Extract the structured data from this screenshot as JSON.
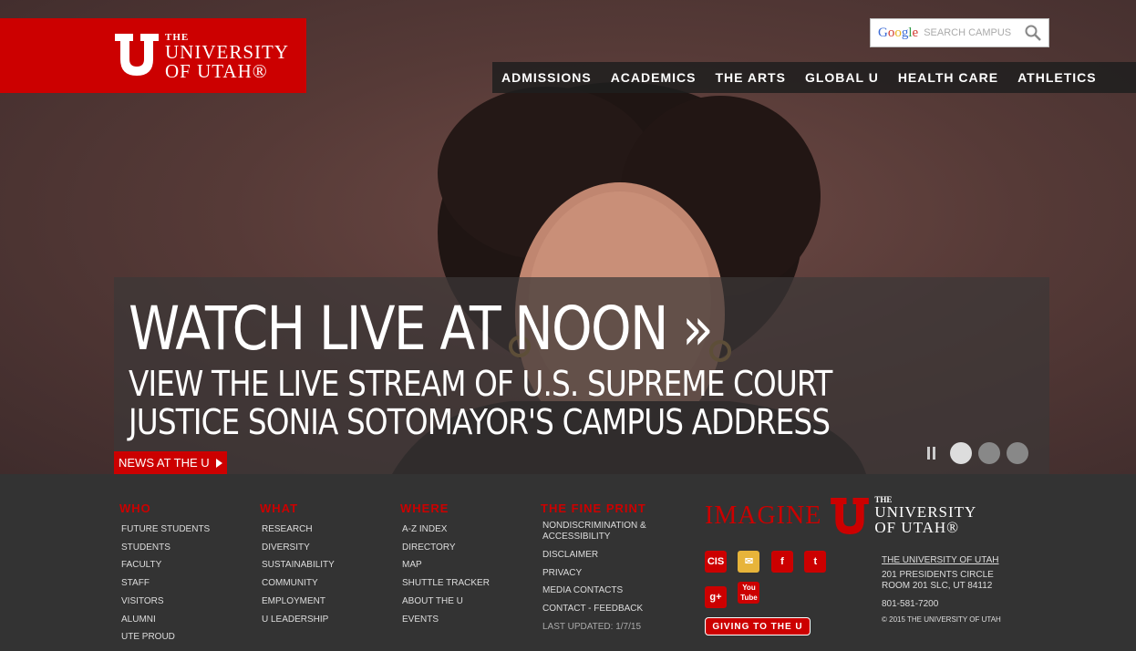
{
  "header": {
    "logo": {
      "the": "THE",
      "line1": "UNIVERSITY",
      "line2": "OF UTAH®"
    },
    "search": {
      "placeholder": "SEARCH CAMPUS",
      "brand": "Google"
    },
    "nav": [
      "ADMISSIONS",
      "ACADEMICS",
      "THE ARTS",
      "GLOBAL U",
      "HEALTH CARE",
      "ATHLETICS"
    ]
  },
  "hero": {
    "title": "WATCH LIVE AT NOON »",
    "subtitle": "VIEW THE LIVE STREAM OF U.S. SUPREME COURT JUSTICE SONIA SOTOMAYOR'S CAMPUS ADDRESS",
    "tag": "NEWS AT THE U",
    "slide_count": 3,
    "active_slide": 1
  },
  "footer": {
    "who": {
      "heading": "WHO",
      "links": [
        "FUTURE STUDENTS",
        "STUDENTS",
        "FACULTY",
        "STAFF",
        "VISITORS",
        "ALUMNI",
        "UTE PROUD"
      ]
    },
    "what": {
      "heading": "WHAT",
      "links": [
        "RESEARCH",
        "DIVERSITY",
        "SUSTAINABILITY",
        "COMMUNITY",
        "EMPLOYMENT",
        "U LEADERSHIP"
      ]
    },
    "where": {
      "heading": "WHERE",
      "links": [
        "A-Z INDEX",
        "DIRECTORY",
        "MAP",
        "SHUTTLE TRACKER",
        "ABOUT THE U",
        "EVENTS"
      ]
    },
    "fineprint": {
      "heading": "THE FINE PRINT",
      "links": [
        "NONDISCRIMINATION & ACCESSIBILITY",
        "DISCLAIMER",
        "PRIVACY",
        "MEDIA CONTACTS",
        "CONTACT - FEEDBACK"
      ],
      "updated": "LAST UPDATED: 1/7/15"
    },
    "imagine": {
      "word": "IMAGINE",
      "the": "THE",
      "line1": "UNIVERSITY",
      "line2": "OF UTAH®"
    },
    "social": [
      {
        "icon": "cis-icon",
        "label": "CIS"
      },
      {
        "icon": "mail-icon",
        "label": "✉"
      },
      {
        "icon": "facebook-icon",
        "label": "f"
      },
      {
        "icon": "twitter-icon",
        "label": "t"
      },
      {
        "icon": "googleplus-icon",
        "label": "g+"
      },
      {
        "icon": "youtube-icon",
        "label": "You Tube"
      }
    ],
    "giving": "GIVING TO THE U",
    "address": {
      "name": "THE UNIVERSITY OF UTAH",
      "line1": "201 PRESIDENTS CIRCLE",
      "line2": "ROOM 201 SLC, UT 84112",
      "phone": "801-581-7200",
      "copyright": "© 2015 THE UNIVERSITY OF UTAH"
    }
  },
  "colors": {
    "brand_red": "#cc0000",
    "footer_bg": "#333333"
  }
}
